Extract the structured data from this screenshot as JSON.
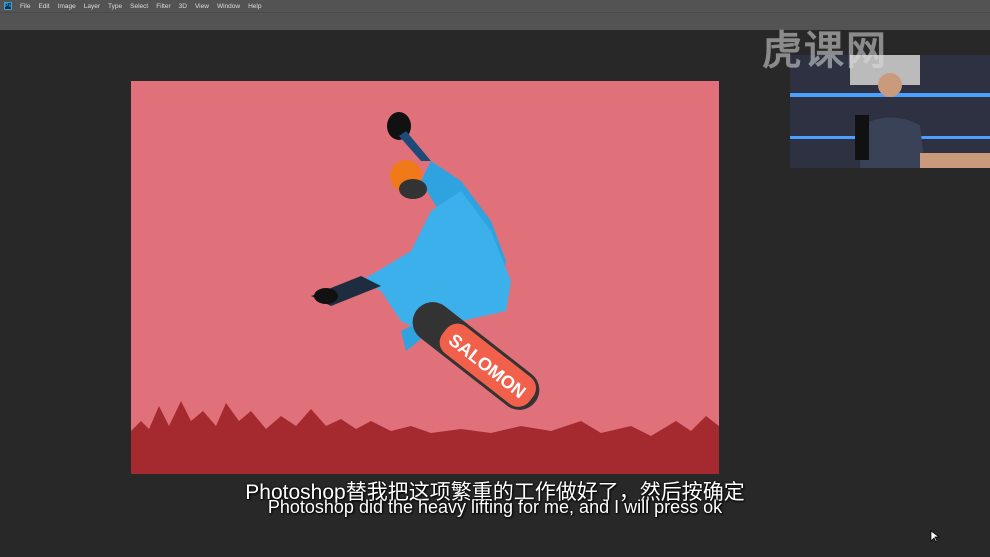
{
  "app": {
    "logo": "Ps",
    "menu": [
      "File",
      "Edit",
      "Image",
      "Layer",
      "Type",
      "Select",
      "Filter",
      "3D",
      "View",
      "Window",
      "Help"
    ]
  },
  "watermark": "虎课网",
  "board_text": "SALOMON",
  "subtitles": {
    "chinese": "Photoshop替我把这项繁重的工作做好了，然后按确定",
    "english": "Photoshop did the heavy lifting for me, and I will press ok"
  },
  "colors": {
    "canvas_bg": "#282828",
    "menubar": "#535353",
    "photo_overlay": "#e0717a"
  }
}
